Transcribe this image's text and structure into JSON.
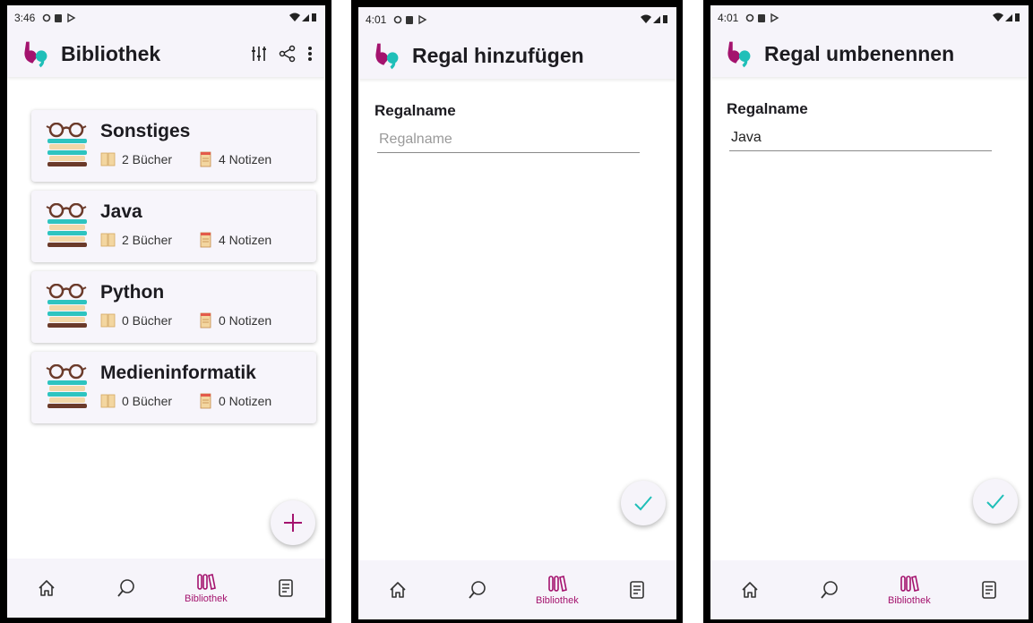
{
  "colors": {
    "brand": "#a4136e",
    "teal": "#1fbfb8",
    "bar_bg": "#f6f4fa"
  },
  "screens": [
    {
      "status": {
        "time": "3:46"
      },
      "appbar": {
        "title": "Bibliothek"
      },
      "shelves": [
        {
          "name": "Sonstiges",
          "books": "2 Bücher",
          "notes": "4 Notizen"
        },
        {
          "name": "Java",
          "books": "2 Bücher",
          "notes": "4 Notizen"
        },
        {
          "name": "Python",
          "books": "0 Bücher",
          "notes": "0 Notizen"
        },
        {
          "name": "Medieninformatik",
          "books": "0 Bücher",
          "notes": "0 Notizen"
        }
      ],
      "nav": {
        "active_label": "Bibliothek"
      }
    },
    {
      "status": {
        "time": "4:01"
      },
      "appbar": {
        "title": "Regal hinzufügen"
      },
      "field": {
        "label": "Regalname",
        "placeholder": "Regalname",
        "value": ""
      },
      "nav": {
        "active_label": "Bibliothek"
      }
    },
    {
      "status": {
        "time": "4:01"
      },
      "appbar": {
        "title": "Regal umbenennen"
      },
      "field": {
        "label": "Regalname",
        "placeholder": "Regalname",
        "value": "Java"
      },
      "nav": {
        "active_label": "Bibliothek"
      }
    }
  ]
}
